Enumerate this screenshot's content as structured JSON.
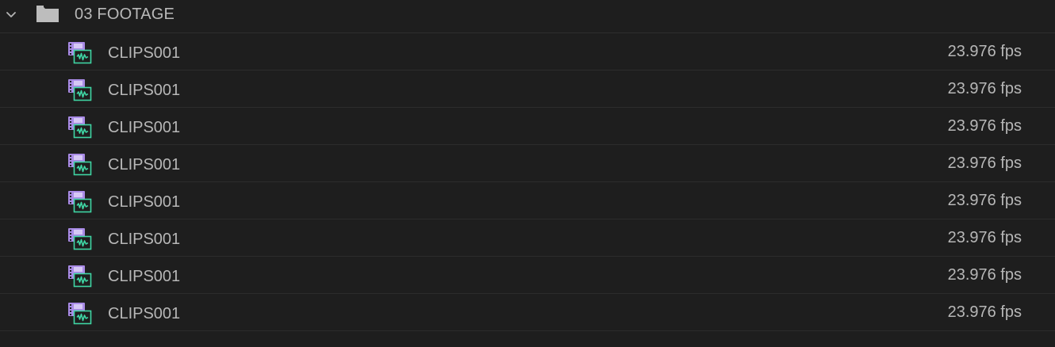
{
  "folder": {
    "name": "03 FOOTAGE",
    "expanded": true,
    "icon": "folder-icon",
    "chevron_icon": "chevron-down-icon"
  },
  "clips": [
    {
      "name": "CLIPS001",
      "fps": "23.976 fps",
      "icon": "video-audio-clip-icon"
    },
    {
      "name": "CLIPS001",
      "fps": "23.976 fps",
      "icon": "video-audio-clip-icon"
    },
    {
      "name": "CLIPS001",
      "fps": "23.976 fps",
      "icon": "video-audio-clip-icon"
    },
    {
      "name": "CLIPS001",
      "fps": "23.976 fps",
      "icon": "video-audio-clip-icon"
    },
    {
      "name": "CLIPS001",
      "fps": "23.976 fps",
      "icon": "video-audio-clip-icon"
    },
    {
      "name": "CLIPS001",
      "fps": "23.976 fps",
      "icon": "video-audio-clip-icon"
    },
    {
      "name": "CLIPS001",
      "fps": "23.976 fps",
      "icon": "video-audio-clip-icon"
    },
    {
      "name": "CLIPS001",
      "fps": "23.976 fps",
      "icon": "video-audio-clip-icon"
    }
  ],
  "colors": {
    "background": "#1e1e1e",
    "text": "#b7b7b7",
    "video_icon": "#a98be6",
    "audio_icon": "#3fd6a4",
    "folder_icon": "#bdbdbd"
  }
}
